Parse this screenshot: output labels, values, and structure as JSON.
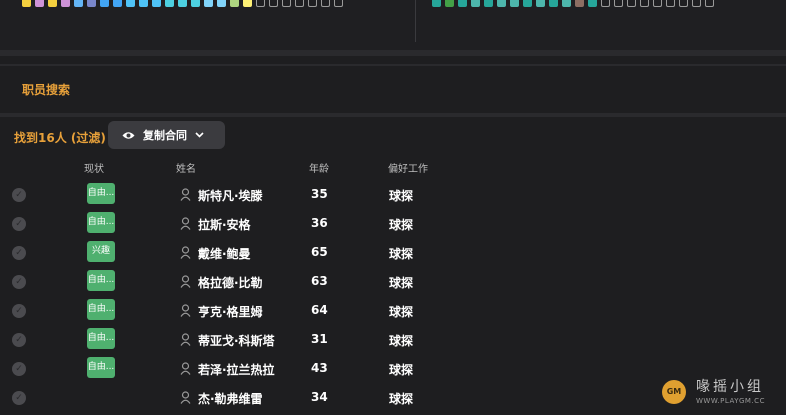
{
  "squad_depth": {
    "left_shirts": [
      "#f4d03f",
      "#ce93d8",
      "#f4d03f",
      "#ce93d8",
      "#64b5f6",
      "#7986cb",
      "#42a5f5",
      "#42a5f5",
      "#4fc3f7",
      "#4fc3f7",
      "#4fc3f7",
      "#4dd0e1",
      "#4dd0e1",
      "#4dd0e1",
      "#81d4fa",
      "#81d4fa",
      "#aed581",
      "#fff176",
      "empty",
      "empty",
      "empty",
      "empty",
      "empty",
      "empty",
      "empty"
    ],
    "right_shirts": [
      "#26a69a",
      "#43a047",
      "#26a69a",
      "#4db6ac",
      "#26a69a",
      "#4db6ac",
      "#4db6ac",
      "#26a69a",
      "#4db6ac",
      "#26a69a",
      "#4db6ac",
      "#8d6e63",
      "#26a69a",
      "empty",
      "empty",
      "empty",
      "empty",
      "empty",
      "empty",
      "empty",
      "empty",
      "empty"
    ]
  },
  "staff_search": {
    "title": "职员搜索"
  },
  "results": {
    "count_label": "找到16人 (过滤)",
    "copy_contract_label": "复制合同"
  },
  "columns": {
    "status": "现状",
    "name": "姓名",
    "age": "年龄",
    "preferred_job": "偏好工作"
  },
  "rows": [
    {
      "status": "自由...",
      "name": "斯特凡·埃滕",
      "age": "35",
      "job": "球探"
    },
    {
      "status": "自由...",
      "name": "拉斯·安格",
      "age": "36",
      "job": "球探"
    },
    {
      "status": "兴趣",
      "name": "戴维·鲍曼",
      "age": "65",
      "job": "球探"
    },
    {
      "status": "自由...",
      "name": "格拉德·比勒",
      "age": "63",
      "job": "球探"
    },
    {
      "status": "自由...",
      "name": "亨克·格里姆",
      "age": "64",
      "job": "球探"
    },
    {
      "status": "自由...",
      "name": "蒂亚戈·科斯塔",
      "age": "31",
      "job": "球探"
    },
    {
      "status": "自由...",
      "name": "若泽·拉兰热拉",
      "age": "43",
      "job": "球探"
    },
    {
      "status": "",
      "name": "杰·勒弗维雷",
      "age": "34",
      "job": "球探"
    }
  ],
  "watermark": {
    "text": "喙摇小组",
    "url": "WWW.PLAYGM.CC",
    "ball": "GM"
  },
  "colors": {
    "accent": "#e8a13a",
    "badge": "#4fb06f",
    "background": "#1e1e20"
  }
}
